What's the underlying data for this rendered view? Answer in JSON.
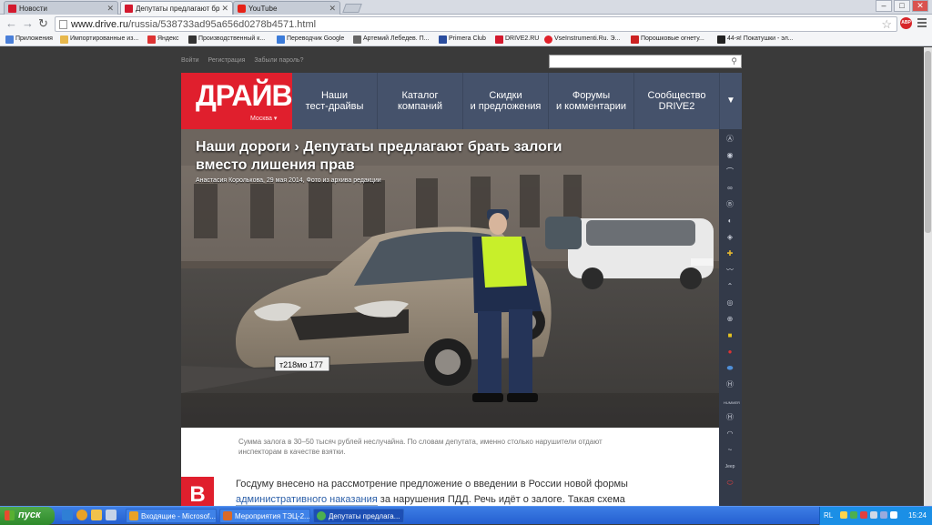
{
  "browser": {
    "tabs": [
      {
        "title": "Новости",
        "active": false,
        "favicon": "drive-favicon"
      },
      {
        "title": "Депутаты предлагают бр",
        "active": true,
        "favicon": "drive-favicon"
      },
      {
        "title": "YouTube",
        "active": false,
        "favicon": "youtube-favicon"
      }
    ],
    "url_host": "www.drive.ru",
    "url_path": "/russia/538733ad95a656d0278b4571.html",
    "bookmarks": [
      {
        "label": "Приложения",
        "color": "#4a7fd8"
      },
      {
        "label": "Импортированные из...",
        "color": "#e7b84d"
      },
      {
        "label": "Яндекс",
        "color": "#d33"
      },
      {
        "label": "Производственный к...",
        "color": "#333"
      },
      {
        "label": "Переводчик Google",
        "color": "#3b7bd9"
      },
      {
        "label": "Артемий Лебедев. П...",
        "color": "#666"
      },
      {
        "label": "Primera Club",
        "color": "#2a4d9e"
      },
      {
        "label": "DRIVE2.RU",
        "color": "#d3192e"
      },
      {
        "label": "VseInstrumenti.Ru. Э...",
        "color": "#e0202a"
      },
      {
        "label": "Порошковые огнету...",
        "color": "#c22"
      },
      {
        "label": "44-я! Покатушки - эл...",
        "color": "#222"
      }
    ]
  },
  "site": {
    "topbar": {
      "login": "Войти",
      "register": "Регистрация",
      "forgot": "Забыли пароль?"
    },
    "logo": {
      "brand": "ДРАЙВ",
      "city": "Москва ▾"
    },
    "nav": [
      {
        "line1": "Наши",
        "line2": "тест-драйвы"
      },
      {
        "line1": "Каталог",
        "line2": "компаний"
      },
      {
        "line1": "Скидки",
        "line2": "и предложения"
      },
      {
        "line1": "Форумы",
        "line2": "и комментарии"
      },
      {
        "line1": "Сообщество",
        "line2": "DRIVE2"
      }
    ],
    "nav_more": "▼",
    "article": {
      "title": "Наши дороги › Депутаты предлагают брать залоги вместо лишения прав",
      "byline": "Анастасия Королькова, 29 мая 2014, Фото из архива редакции",
      "plate": "т218мо 177",
      "caption": "Сумма залога в 30–50 тысяч рублей неслучайна. По словам депутата, именно столько нарушители отдают инспекторам в качестве взятки.",
      "drop_cap": "В",
      "body_start": "Госдуму внесено на рассмотрение предложение о введении в России новой формы ",
      "body_link": "административного наказания",
      "body_end": " за нарушения ПДД. Речь идёт о залоге. Такая схема"
    },
    "brand_icons": [
      "acura-icon",
      "alfa-romeo-icon",
      "aston-martin-icon",
      "audi-icon",
      "bentley-icon",
      "bmw-icon",
      "cadillac-icon",
      "chevrolet-icon",
      "chrysler-icon",
      "citroen-icon",
      "daewoo-icon",
      "dodge-icon",
      "ferrari-icon",
      "fiat-icon",
      "ford-icon",
      "honda-icon",
      "hummer-icon",
      "hyundai-icon",
      "infiniti-icon",
      "jaguar-icon",
      "jeep-icon",
      "kia-icon"
    ],
    "brand_labels": {
      "hummer": "HUMMER",
      "jeep": "Jeep"
    }
  },
  "taskbar": {
    "start": "пуск",
    "tasks": [
      {
        "label": "Входящие - Microsof...",
        "active": false,
        "color": "#e9a227"
      },
      {
        "label": "Мероприятия ТЭЦ-2...",
        "active": false,
        "color": "#d96a2a"
      },
      {
        "label": "Депутаты предлага...",
        "active": true,
        "color": "#4caf50"
      }
    ],
    "lang": "RL",
    "clock": "15:24"
  }
}
